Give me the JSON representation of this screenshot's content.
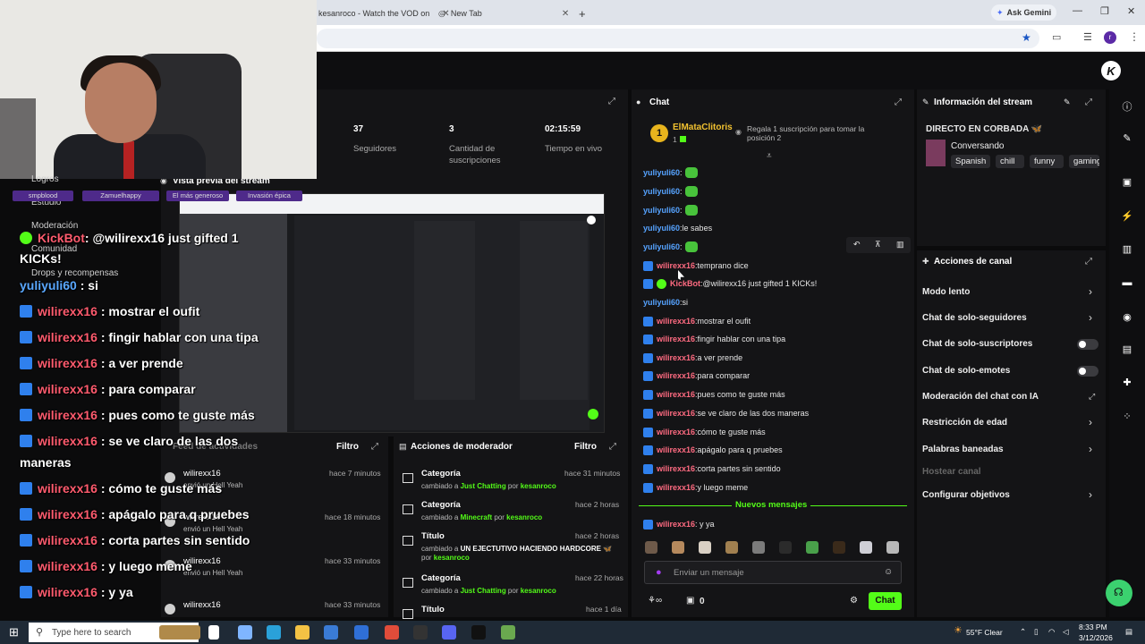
{
  "browser": {
    "tab1_title": "kesanroco - Watch the VOD on",
    "tab2_title": "New Tab",
    "ask_gemini": "Ask Gemini"
  },
  "stats": {
    "followers_value": "37",
    "followers_label": "Seguidores",
    "subs_value": "3",
    "subs_label": "Cantidad de suscripciones",
    "uptime_value": "02:15:59",
    "uptime_label": "Tiempo en vivo"
  },
  "preview": {
    "title": "Vista previa del stream"
  },
  "chat": {
    "title": "Chat",
    "pinned_user": "ElMataClitoris",
    "pinned_count": "1",
    "gift_prompt": "Regala 1 suscripción para tomar la posición 2",
    "lines": [
      {
        "user": "yuliyuli60",
        "sep": ":",
        "text": "",
        "color": "blue",
        "badge": false,
        "emote": true
      },
      {
        "user": "yuliyuli60",
        "sep": ":",
        "text": "",
        "color": "blue",
        "badge": false,
        "emote": true
      },
      {
        "user": "yuliyuli60",
        "sep": ":",
        "text": "",
        "color": "blue",
        "badge": false,
        "emote": true
      },
      {
        "user": "yuliyuli60",
        "sep": ":",
        "text": " le sabes",
        "color": "blue",
        "badge": false,
        "emote": false
      },
      {
        "user": "yuliyuli60",
        "sep": ":",
        "text": "",
        "color": "blue",
        "badge": false,
        "emote": true
      },
      {
        "user": "wilirexx16",
        "sep": ":",
        "text": " temprano dice",
        "color": "red",
        "badge": true,
        "emote": false
      },
      {
        "user": "KickBot",
        "sep": ":",
        "text": " @wilirexx16 just gifted 1 KICKs!",
        "color": "red",
        "badge": true,
        "emote": false
      },
      {
        "user": "yuliyuli60",
        "sep": ":",
        "text": " si",
        "color": "blue",
        "badge": false,
        "emote": false
      },
      {
        "user": "wilirexx16",
        "sep": ":",
        "text": " mostrar el oufit",
        "color": "red",
        "badge": true,
        "emote": false
      },
      {
        "user": "wilirexx16",
        "sep": ":",
        "text": " fingir hablar con una tipa",
        "color": "red",
        "badge": true,
        "emote": false
      },
      {
        "user": "wilirexx16",
        "sep": ":",
        "text": " a ver prende",
        "color": "red",
        "badge": true,
        "emote": false
      },
      {
        "user": "wilirexx16",
        "sep": ":",
        "text": " para comparar",
        "color": "red",
        "badge": true,
        "emote": false
      },
      {
        "user": "wilirexx16",
        "sep": ":",
        "text": " pues como te guste más",
        "color": "red",
        "badge": true,
        "emote": false
      },
      {
        "user": "wilirexx16",
        "sep": ":",
        "text": " se ve claro de las dos maneras",
        "color": "red",
        "badge": true,
        "emote": false
      },
      {
        "user": "wilirexx16",
        "sep": ":",
        "text": " cómo te guste más",
        "color": "red",
        "badge": true,
        "emote": false
      },
      {
        "user": "wilirexx16",
        "sep": ":",
        "text": " apágalo para q pruebes",
        "color": "red",
        "badge": true,
        "emote": false
      },
      {
        "user": "wilirexx16",
        "sep": ":",
        "text": " corta partes sin sentido",
        "color": "red",
        "badge": true,
        "emote": false
      },
      {
        "user": "wilirexx16",
        "sep": ":",
        "text": " y luego meme",
        "color": "red",
        "badge": true,
        "emote": false
      }
    ],
    "new_messages": "Nuevos mensajes",
    "last_line": {
      "user": "wilirexx16",
      "text": ": y ya"
    },
    "input_placeholder": "Enviar un mensaje",
    "points": "0",
    "send": "Chat"
  },
  "stream_info": {
    "title": "Información del stream",
    "stream_title": "DIRECTO EN CORBADA 🦋",
    "category": "Conversando",
    "tags": [
      "Spanish",
      "chill",
      "funny",
      "gaming"
    ]
  },
  "channel_actions": {
    "title": "Acciones de canal",
    "items": [
      {
        "label": "Modo lento",
        "control": "chevron"
      },
      {
        "label": "Chat de solo-seguidores",
        "control": "chevron"
      },
      {
        "label": "Chat de solo-suscriptores",
        "control": "toggle"
      },
      {
        "label": "Chat de solo-emotes",
        "control": "toggle"
      },
      {
        "label": "Moderación del chat con IA",
        "control": "external"
      },
      {
        "label": "Restricción de edad",
        "control": "chevron"
      },
      {
        "label": "Palabras baneadas",
        "control": "chevron"
      },
      {
        "label": "Hostear canal",
        "control": "none"
      },
      {
        "label": "Configurar objetivos",
        "control": "chevron"
      }
    ]
  },
  "activity": {
    "title": "Feed de actividades",
    "filter": "Filtro",
    "items": [
      {
        "user": "wilirexx16",
        "sub": "envió un Hell Yeah",
        "time": "hace 7 minutos"
      },
      {
        "user": "wilirexx16",
        "sub": "envió un Hell Yeah",
        "time": "hace 18 minutos"
      },
      {
        "user": "wilirexx16",
        "sub": "envió un Hell Yeah",
        "time": "hace 33 minutos"
      },
      {
        "user": "wilirexx16",
        "sub": "",
        "time": "hace 33 minutos"
      }
    ]
  },
  "mod_actions": {
    "title": "Acciones de moderador",
    "filter": "Filtro",
    "items": [
      {
        "title": "Categoría",
        "pre": "cambiado a ",
        "value": "Just Chatting",
        "by": " por ",
        "who": "kesanroco",
        "time": "hace 31 minutos"
      },
      {
        "title": "Categoría",
        "pre": "cambiado a ",
        "value": "Minecraft",
        "by": " por ",
        "who": "kesanroco",
        "time": "hace 2 horas"
      },
      {
        "title": "Título",
        "pre": "cambiado a ",
        "value": "UN EJECTUTIVO HACIENDO HARDCORE 🦋",
        "by": " por ",
        "who": "kesanroco",
        "time": "hace 2 horas"
      },
      {
        "title": "Categoría",
        "pre": "cambiado a ",
        "value": "Just Chatting",
        "by": " por ",
        "who": "kesanroco",
        "time": "hace 22 horas"
      },
      {
        "title": "Título",
        "pre": "",
        "value": "",
        "by": "",
        "who": "",
        "time": "hace 1 día"
      }
    ]
  },
  "sidebar_left": {
    "items": [
      "Logros",
      "Comunidad",
      "Estudio",
      "Moderación",
      "Drops y recompensas"
    ]
  },
  "overlay": {
    "badges": [
      "smpblood",
      "Zamuelhappy",
      "El más generoso",
      "Invasión épica"
    ],
    "kickbot_user": "KickBot",
    "kickbot_msg": ": @wilirexx16 just gifted 1",
    "kickbot_msg2": "KICKs!",
    "lines": [
      {
        "user": "yuliyuli60",
        "text": " : si",
        "color": "blue",
        "badge": false
      },
      {
        "user": "wilirexx16",
        "text": " : mostrar el oufit",
        "color": "red",
        "badge": true
      },
      {
        "user": "wilirexx16",
        "text": " : fingir hablar con una tipa",
        "color": "red",
        "badge": true
      },
      {
        "user": "wilirexx16",
        "text": " : a ver prende",
        "color": "red",
        "badge": true
      },
      {
        "user": "wilirexx16",
        "text": " : para comparar",
        "color": "red",
        "badge": true
      },
      {
        "user": "wilirexx16",
        "text": " : pues como te guste más",
        "color": "red",
        "badge": true
      },
      {
        "user": "wilirexx16",
        "text": " : se ve claro de las dos",
        "color": "red",
        "badge": true
      },
      {
        "user": "",
        "text": "maneras",
        "color": "white",
        "badge": false
      },
      {
        "user": "wilirexx16",
        "text": " : cómo te guste más",
        "color": "red",
        "badge": true
      },
      {
        "user": "wilirexx16",
        "text": " : apágalo para q pruebes",
        "color": "red",
        "badge": true
      },
      {
        "user": "wilirexx16",
        "text": " : corta partes sin sentido",
        "color": "red",
        "badge": true
      },
      {
        "user": "wilirexx16",
        "text": " : y luego meme",
        "color": "red",
        "badge": true
      },
      {
        "user": "wilirexx16",
        "text": " : y ya",
        "color": "red",
        "badge": true
      }
    ]
  },
  "taskbar": {
    "search_placeholder": "Type here to search",
    "weather": "55°F  Clear",
    "time": "8:33 PM",
    "date": "3/12/2026"
  },
  "colors": {
    "kick_green": "#53fc18",
    "panel": "#141416",
    "user_red": "#ff6b81",
    "user_blue": "#56a3ff"
  }
}
